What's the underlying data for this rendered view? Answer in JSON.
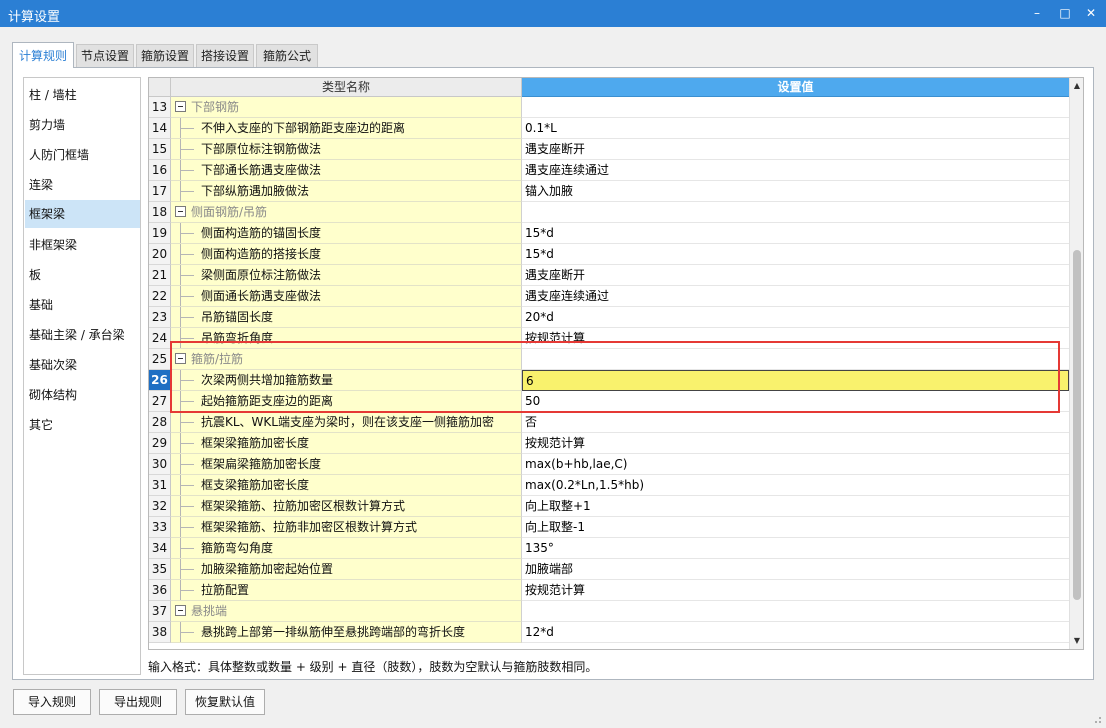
{
  "window": {
    "title": "计算设置",
    "minimize": "–",
    "maximize": "□",
    "close": "✕"
  },
  "tabs": [
    {
      "label": "计算规则",
      "active": true
    },
    {
      "label": "节点设置",
      "active": false
    },
    {
      "label": "箍筋设置",
      "active": false
    },
    {
      "label": "搭接设置",
      "active": false
    },
    {
      "label": "箍筋公式",
      "active": false
    }
  ],
  "sidebar": {
    "items": [
      {
        "label": "柱 / 墙柱"
      },
      {
        "label": "剪力墙"
      },
      {
        "label": "人防门框墙"
      },
      {
        "label": "连梁"
      },
      {
        "label": "框架梁"
      },
      {
        "label": "非框架梁"
      },
      {
        "label": "板"
      },
      {
        "label": "基础"
      },
      {
        "label": "基础主梁 / 承台梁"
      },
      {
        "label": "基础次梁"
      },
      {
        "label": "砌体结构"
      },
      {
        "label": "其它"
      }
    ],
    "selected_index": 4
  },
  "grid": {
    "columns": {
      "name": "类型名称",
      "value": "设置值"
    },
    "selected_row": 26,
    "rows": [
      {
        "num": "13",
        "group": true,
        "name": "下部钢筋",
        "value": ""
      },
      {
        "num": "14",
        "name": "不伸入支座的下部钢筋距支座边的距离",
        "value": "0.1*L"
      },
      {
        "num": "15",
        "name": "下部原位标注钢筋做法",
        "value": "遇支座断开"
      },
      {
        "num": "16",
        "name": "下部通长筋遇支座做法",
        "value": "遇支座连续通过"
      },
      {
        "num": "17",
        "name": "下部纵筋遇加腋做法",
        "value": "锚入加腋"
      },
      {
        "num": "18",
        "group": true,
        "name": "侧面钢筋/吊筋",
        "value": ""
      },
      {
        "num": "19",
        "name": "侧面构造筋的锚固长度",
        "value": "15*d"
      },
      {
        "num": "20",
        "name": "侧面构造筋的搭接长度",
        "value": "15*d"
      },
      {
        "num": "21",
        "name": "梁侧面原位标注筋做法",
        "value": "遇支座断开"
      },
      {
        "num": "22",
        "name": "侧面通长筋遇支座做法",
        "value": "遇支座连续通过"
      },
      {
        "num": "23",
        "name": "吊筋锚固长度",
        "value": "20*d"
      },
      {
        "num": "24",
        "name": "吊筋弯折角度",
        "value": "按规范计算"
      },
      {
        "num": "25",
        "group": true,
        "name": "箍筋/拉筋",
        "value": ""
      },
      {
        "num": "26",
        "name": "次梁两侧共增加箍筋数量",
        "value": "6"
      },
      {
        "num": "27",
        "name": "起始箍筋距支座边的距离",
        "value": "50"
      },
      {
        "num": "28",
        "name": "抗震KL、WKL端支座为梁时，则在该支座一侧箍筋加密",
        "value": "否"
      },
      {
        "num": "29",
        "name": "框架梁箍筋加密长度",
        "value": "按规范计算"
      },
      {
        "num": "30",
        "name": "框架扁梁箍筋加密长度",
        "value": "max(b+hb,lae,C)"
      },
      {
        "num": "31",
        "name": "框支梁箍筋加密长度",
        "value": "max(0.2*Ln,1.5*hb)"
      },
      {
        "num": "32",
        "name": "框架梁箍筋、拉筋加密区根数计算方式",
        "value": "向上取整+1"
      },
      {
        "num": "33",
        "name": "框架梁箍筋、拉筋非加密区根数计算方式",
        "value": "向上取整-1"
      },
      {
        "num": "34",
        "name": "箍筋弯勾角度",
        "value": "135°"
      },
      {
        "num": "35",
        "name": "加腋梁箍筋加密起始位置",
        "value": "加腋端部"
      },
      {
        "num": "36",
        "name": "拉筋配置",
        "value": "按规范计算"
      },
      {
        "num": "37",
        "group": true,
        "name": "悬挑端",
        "value": ""
      },
      {
        "num": "38",
        "name": "悬挑跨上部第一排纵筋伸至悬挑跨端部的弯折长度",
        "value": "12*d"
      }
    ]
  },
  "hint": "输入格式：具体整数或数量 + 级别 + 直径（肢数），肢数为空默认与箍筋肢数相同。",
  "buttons": {
    "import": "导入规则",
    "export": "导出规则",
    "reset": "恢复默认值"
  }
}
